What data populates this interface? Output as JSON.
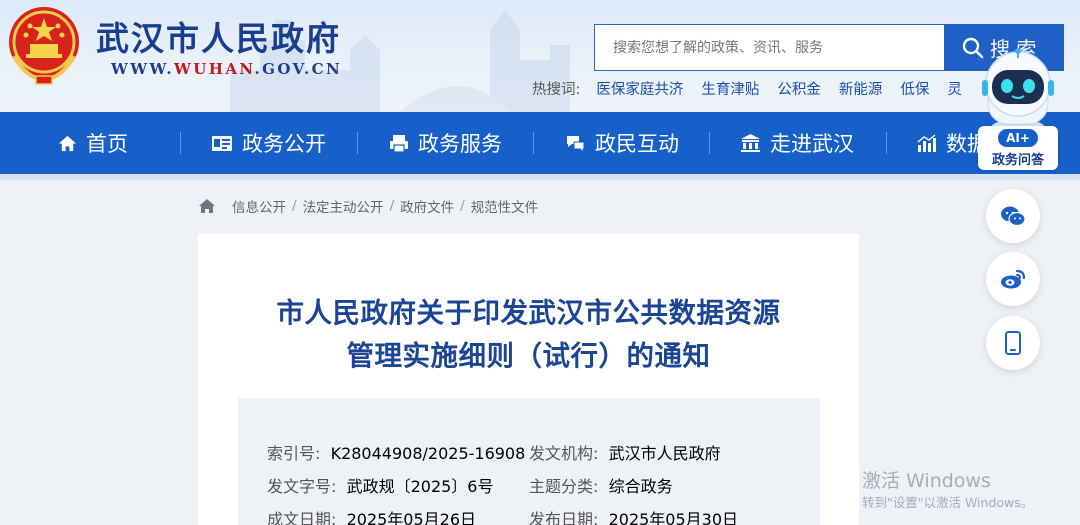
{
  "site": {
    "title": "武汉市人民政府",
    "url_prefix": "WWW.",
    "url_brand": "WUHAN",
    "url_suffix": ".GOV.CN"
  },
  "search": {
    "placeholder": "搜索您想了解的政策、资讯、服务",
    "button_label": "搜 索",
    "hot_label": "热搜词:",
    "hot_words": [
      "医保家庭共济",
      "生育津贴",
      "公积金",
      "新能源",
      "低保",
      "灵"
    ]
  },
  "nav": {
    "items": [
      {
        "label": "首页",
        "icon": "home-icon"
      },
      {
        "label": "政务公开",
        "icon": "id-card-icon"
      },
      {
        "label": "政务服务",
        "icon": "printer-icon"
      },
      {
        "label": "政民互动",
        "icon": "chat-icon"
      },
      {
        "label": "走进武汉",
        "icon": "building-icon"
      },
      {
        "label": "数据",
        "icon": "chart-icon"
      }
    ]
  },
  "ai_assistant": {
    "badge": "AI+",
    "label": "政务问答"
  },
  "breadcrumb": [
    "信息公开",
    "法定主动公开",
    "政府文件",
    "规范性文件"
  ],
  "article": {
    "title_line1": "市人民政府关于印发武汉市公共数据资源",
    "title_line2": "管理实施细则（试行）的通知",
    "meta": {
      "index_key": "索引号:",
      "index_val": "K28044908/2025-16908",
      "org_key": "发文机构:",
      "org_val": "武汉市人民政府",
      "doc_no_key": "发文字号:",
      "doc_no_val": "武政规〔2025〕6号",
      "topic_key": "主题分类:",
      "topic_val": "综合政务",
      "date_key": "成文日期:",
      "date_val": "2025年05月26日",
      "pub_key": "发布日期:",
      "pub_val": "2025年05月30日"
    }
  },
  "watermark": {
    "line1": "激活 Windows",
    "line2": "转到\"设置\"以激活 Windows。"
  },
  "colors": {
    "primary": "#1760c9",
    "title": "#1d4596",
    "accent_red": "#c8161d"
  }
}
